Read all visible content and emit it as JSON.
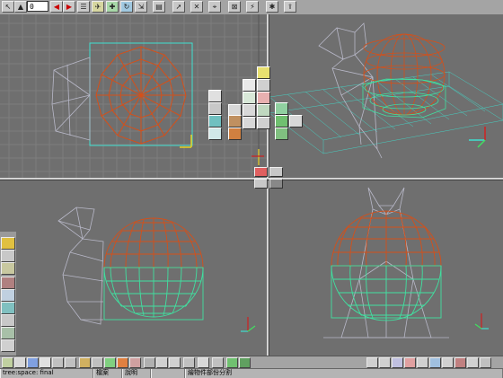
{
  "toolbar": {
    "frame_value": "0",
    "icons": [
      "select-arrow-icon",
      "frame-field",
      "play-reverse-icon",
      "play-forward-icon",
      "menu-list-icon",
      "camera-icon",
      "move-icon",
      "rotate-icon",
      "scale-icon",
      "save-icon",
      "tool-arrow-icon",
      "crossed-tool-icon",
      "group-icon",
      "ungroup-icon",
      "link-icon",
      "material-icon",
      "render-icon",
      "undo-icon",
      "redo-icon"
    ]
  },
  "status": {
    "filename": "tree:space: final",
    "file_menu": "檔案",
    "help_menu": "說明",
    "message": "繪物件部份分割"
  },
  "colors": {
    "viewport_bg": "#6f6f6f",
    "grid": "#7c7c7c",
    "grid_cyan": "#3fe0d0",
    "sphere_orange": "#d4501a",
    "sphere_green": "#40e0a0",
    "wire_gray": "#b8b8c8",
    "accent_yellow": "#e8d020"
  }
}
